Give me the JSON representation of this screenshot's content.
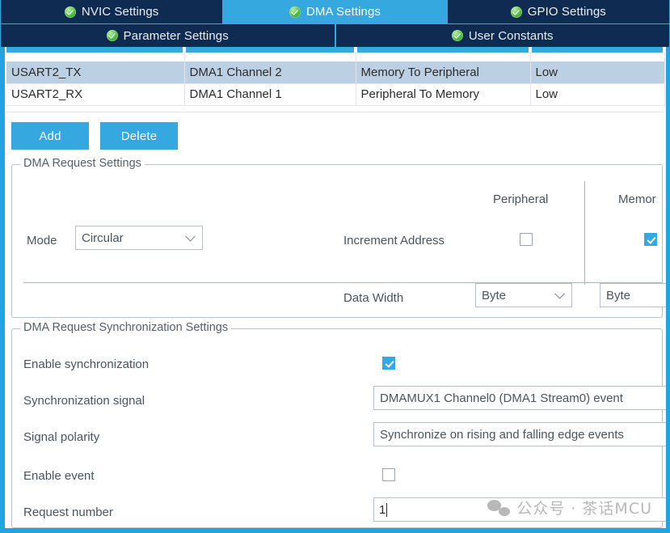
{
  "tabs_row1": [
    {
      "label": "NVIC Settings",
      "selected": false,
      "icon": "green-check-icon"
    },
    {
      "label": "DMA Settings",
      "selected": true,
      "icon": "green-check-icon"
    },
    {
      "label": "GPIO Settings",
      "selected": false,
      "icon": "green-check-icon"
    }
  ],
  "tabs_row2": [
    {
      "label": "Parameter Settings",
      "selected": false,
      "icon": "green-check-icon"
    },
    {
      "label": "User Constants",
      "selected": false,
      "icon": "green-check-icon"
    }
  ],
  "table": {
    "rows": [
      {
        "selected": true,
        "request": "USART2_TX",
        "channel": "DMA1 Channel 2",
        "direction": "Memory To Peripheral",
        "priority": "Low"
      },
      {
        "selected": false,
        "request": "USART2_RX",
        "channel": "DMA1 Channel 1",
        "direction": "Peripheral To Memory",
        "priority": "Low"
      }
    ]
  },
  "buttons": {
    "add_label": "Add",
    "delete_label": "Delete"
  },
  "dma_request_settings": {
    "legend": "DMA Request Settings",
    "col_peripheral": "Peripheral",
    "col_memory": "Memor",
    "mode_label": "Mode",
    "mode_value": "Circular",
    "increment_address_label": "Increment Address",
    "increment_peripheral_checked": false,
    "increment_memory_checked": true,
    "data_width_label": "Data Width",
    "data_width_peripheral": "Byte",
    "data_width_memory": "Byte"
  },
  "dma_sync_settings": {
    "legend": "DMA Request Synchronization Settings",
    "enable_sync_label": "Enable synchronization",
    "enable_sync_checked": true,
    "sync_signal_label": "Synchronization signal",
    "sync_signal_value": "DMAMUX1 Channel0 (DMA1 Stream0) event",
    "signal_polarity_label": "Signal polarity",
    "signal_polarity_value": "Synchronize on rising and falling edge events",
    "enable_event_label": "Enable event",
    "enable_event_checked": false,
    "request_number_label": "Request number",
    "request_number_value": "1"
  },
  "watermark": {
    "text": "公众号 · 茶话MCU",
    "icon": "wechat-icon"
  },
  "colors": {
    "accent_blue": "#35a8e0",
    "tab_dark": "#0f2b52",
    "row_selected": "#bcd0e3"
  }
}
